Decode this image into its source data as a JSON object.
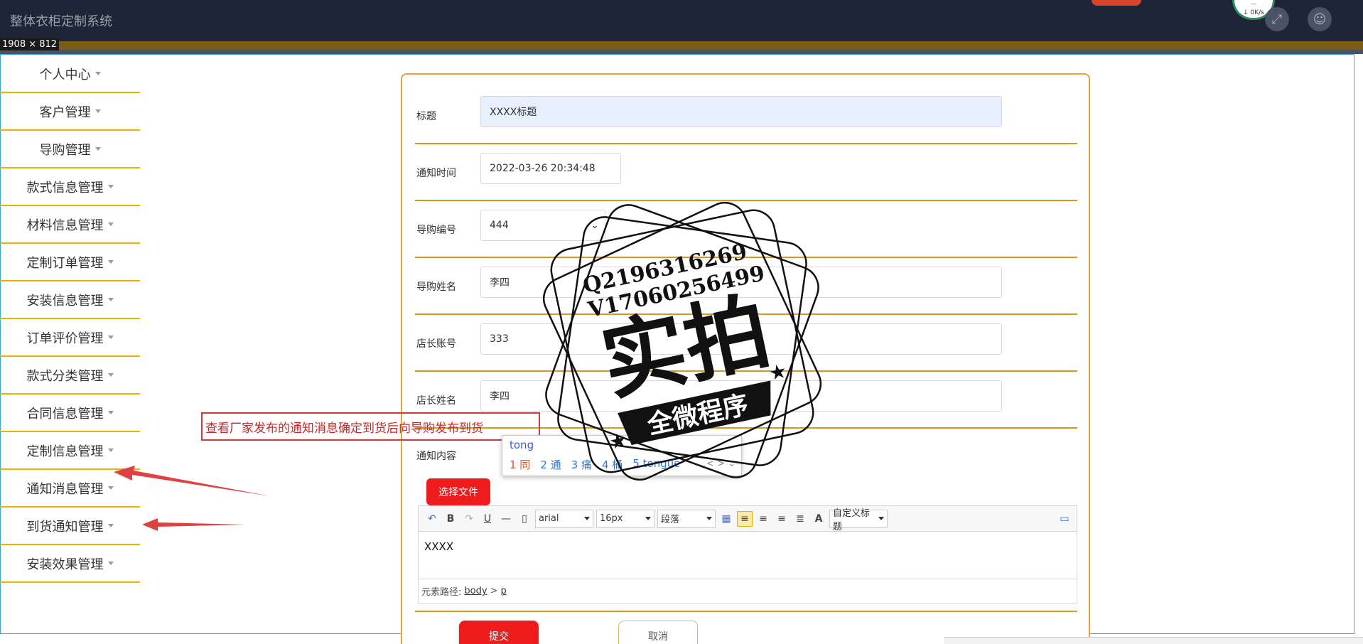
{
  "header": {
    "app_title": "整体衣柜定制系统",
    "size_badge": "1908 × 812",
    "net_down": "↓ 0K/s",
    "fullscreen_icon": "expand-icon",
    "user_icon": "user-icon"
  },
  "sidebar": {
    "items": [
      {
        "label": "个人中心"
      },
      {
        "label": "客户管理"
      },
      {
        "label": "导购管理"
      },
      {
        "label": "款式信息管理"
      },
      {
        "label": "材料信息管理"
      },
      {
        "label": "定制订单管理"
      },
      {
        "label": "安装信息管理"
      },
      {
        "label": "订单评价管理"
      },
      {
        "label": "款式分类管理"
      },
      {
        "label": "合同信息管理"
      },
      {
        "label": "定制信息管理"
      },
      {
        "label": "通知消息管理"
      },
      {
        "label": "到货通知管理"
      },
      {
        "label": "安装效果管理"
      }
    ]
  },
  "form": {
    "title_label": "标题",
    "title_value": "XXXX标题",
    "time_label": "通知时间",
    "time_value": "2022-03-26 20:34:48",
    "guide_no_label": "导购编号",
    "guide_no_value": "444",
    "guide_name_label": "导购姓名",
    "guide_name_value": "李四",
    "manager_acct_label": "店长账号",
    "manager_acct_value": "333",
    "manager_name_label": "店长姓名",
    "manager_name_value": "李四",
    "content_label": "通知内容",
    "file_button": "选择文件",
    "submit": "提交",
    "cancel": "取消"
  },
  "editor": {
    "font": "arial",
    "size": "16px",
    "paragraph": "段落",
    "custom_title": "自定义标题",
    "body_text": "XXXX",
    "path_label": "元素路径:",
    "path_body": "body",
    "path_sep": ">",
    "path_p": "p"
  },
  "annotation": {
    "text": "查看厂家发布的通知消息确定到货后向导购发布到货"
  },
  "ime": {
    "input": "tong",
    "candidates": [
      "1 同",
      "2 通",
      "3 痛",
      "4 桶",
      "5 tongue"
    ],
    "nav": "< >  ⌄"
  },
  "stamp": {
    "line1": "Q2196316269",
    "line2": "V17060256499",
    "big": "实拍",
    "banner": "全微程序"
  },
  "colors": {
    "header_bg": "#1d2536",
    "sidebar_border": "#e4b600",
    "card_border": "#e3a43a",
    "accent_red": "#ee1c1c"
  }
}
